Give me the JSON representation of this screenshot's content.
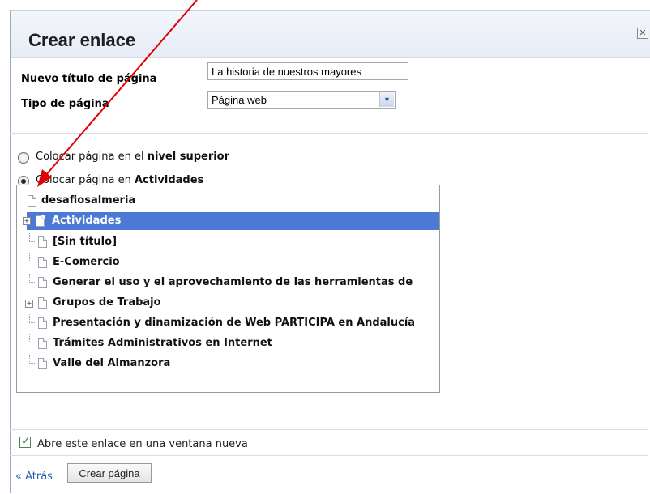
{
  "dialog": {
    "title": "Crear enlace",
    "close_glyph": "✕"
  },
  "form": {
    "title_label": "Nuevo título de página",
    "title_value": "La historia de nuestros mayores",
    "type_label": "Tipo de página",
    "type_value": "Página web"
  },
  "placement": {
    "option_top_prefix": "Colocar página en el ",
    "option_top_bold": "nivel superior",
    "option_under_prefix": "Colocar página en ",
    "option_under_bold": "Actividades",
    "selected": "under"
  },
  "tree": {
    "root": "desafiosalmeria",
    "selected_item": "Actividades",
    "children": [
      "[Sin título]",
      "E-Comercio",
      "Generar el uso y el aprovechamiento de las herramientas de",
      "Grupos de Trabajo",
      "Presentación y dinamización de Web PARTICIPA en Andalucía",
      "Trámites Administrativos en Internet",
      "Valle del Almanzora"
    ]
  },
  "footer": {
    "new_window_label": "Abre este enlace en una ventana nueva",
    "new_window_checked": true,
    "back_link": "« Atrás",
    "create_button": "Crear página"
  },
  "colors": {
    "selection": "#4d79d6",
    "annotation_arrow": "#e00000",
    "link": "#2a5db0"
  }
}
